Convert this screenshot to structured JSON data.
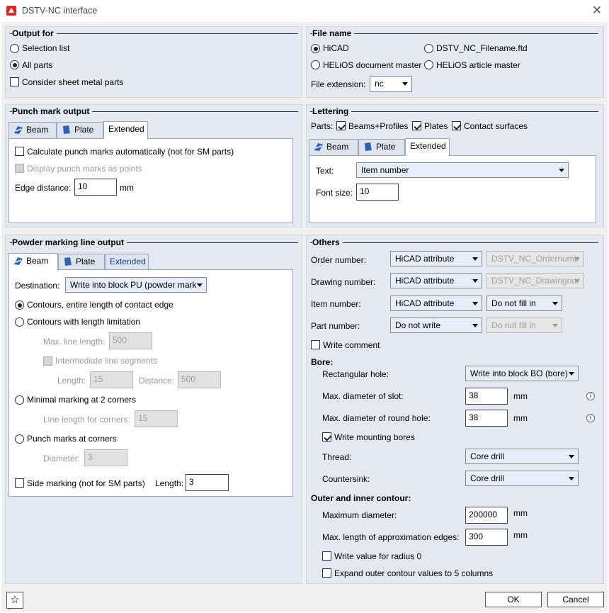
{
  "window": {
    "title": "DSTV-NC interface"
  },
  "output_for": {
    "heading": "Output for",
    "selection_list": "Selection list",
    "all_parts": "All parts",
    "sheet_metal": "Consider sheet metal parts"
  },
  "file_name": {
    "heading": "File name",
    "hicad": "HiCAD",
    "ftd": "DSTV_NC_Filename.ftd",
    "helios_doc": "HELiOS document master",
    "helios_article": "HELiOS article master",
    "ext_label": "File extension:",
    "ext_value": "nc"
  },
  "punch": {
    "heading": "Punch mark output",
    "tabs": [
      "Beam",
      "Plate",
      "Extended"
    ],
    "auto": "Calculate punch marks automatically (not for SM parts)",
    "points": "Display punch marks as points",
    "edge_label": "Edge distance:",
    "edge_value": "10",
    "unit": "mm"
  },
  "lettering": {
    "heading": "Lettering",
    "parts_label": "Parts:",
    "beams": "Beams+Profiles",
    "plates": "Plates",
    "contact": "Contact surfaces",
    "tabs": [
      "Beam",
      "Plate",
      "Extended"
    ],
    "text_label": "Text:",
    "text_value": "Item number",
    "font_label": "Font size:",
    "font_value": "10"
  },
  "powder": {
    "heading": "Powder marking line output",
    "tabs": [
      "Beam",
      "Plate",
      "Extended"
    ],
    "dest_label": "Destination:",
    "dest_value": "Write into block PU (powder mark",
    "contours_entire": "Contours, entire length of contact edge",
    "contours_limit": "Contours with length limitation",
    "max_line_label": "Max. line length:",
    "max_line_value": "500",
    "intermediate": "Intermediate line segments",
    "length_label": "Length:",
    "length_value": "15",
    "distance_label": "Distance:",
    "distance_value": "500",
    "minimal": "Minimal marking at 2 corners",
    "corner_len_label": "Line length for corners:",
    "corner_len_value": "15",
    "punch_corners": "Punch marks at corners",
    "diameter_label": "Diameter:",
    "diameter_value": "3",
    "side": "Side marking (not for SM parts)",
    "side_len_label": "Length:",
    "side_len_value": "3"
  },
  "others": {
    "heading": "Others",
    "order_label": "Order number:",
    "order_sel": "HiCAD attribute",
    "order_attr": "DSTV_NC_Ordernumb",
    "drawing_label": "Drawing number:",
    "drawing_sel": "HiCAD attribute",
    "drawing_attr": "DSTV_NC_Drawingnur",
    "item_label": "Item number:",
    "item_sel": "HiCAD attribute",
    "item_fill": "Do not fill in",
    "part_label": "Part number:",
    "part_sel": "Do not write",
    "part_fill": "Do not fill in",
    "write_comment": "Write comment",
    "bore_heading": "Bore:",
    "rect_label": "Rectangular hole:",
    "rect_value": "Write into block BO (bore)",
    "slot_label": "Max. diameter of slot:",
    "slot_value": "38",
    "round_label": "Max. diameter of round hole:",
    "round_value": "38",
    "mounting": "Write mounting bores",
    "thread_label": "Thread:",
    "thread_value": "Core drill",
    "countersink_label": "Countersink:",
    "countersink_value": "Core drill",
    "contour_heading": "Outer and inner contour:",
    "maxdiam_label": "Maximum diameter:",
    "maxdiam_value": "200000",
    "approx_label": "Max. length of approximation edges:",
    "approx_value": "300",
    "radius0": "Write value for radius 0",
    "expand": "Expand outer contour values to 5 columns",
    "unit": "mm",
    "info": "i"
  },
  "footer": {
    "ok": "OK",
    "cancel": "Cancel"
  }
}
